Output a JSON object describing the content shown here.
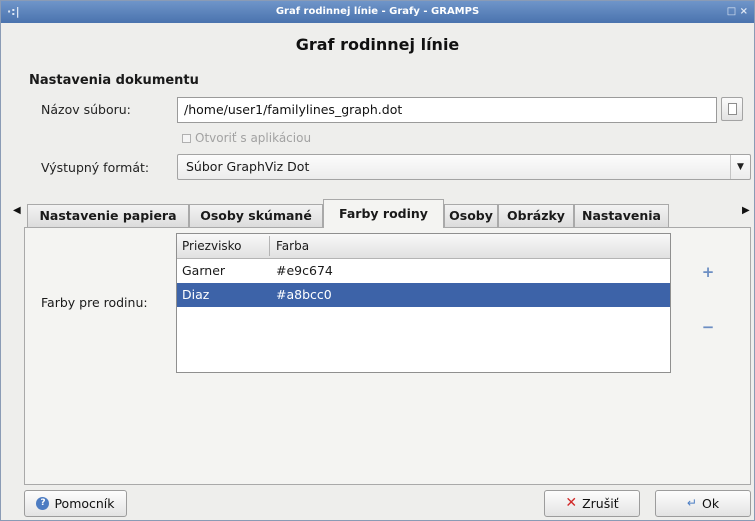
{
  "window": {
    "title": "Graf rodinnej línie - Grafy - GRAMPS",
    "menu_glyph": "·:|",
    "close_glyph": "□ ×"
  },
  "header": {
    "title": "Graf rodinnej línie"
  },
  "document_settings": {
    "section_title": "Nastavenia dokumentu",
    "filename_label": "Názov súboru:",
    "filename_value": "/home/user1/familylines_graph.dot",
    "open_with_app_label": "Otvoriť s aplikáciou",
    "open_with_app_checked": false,
    "format_label": "Výstupný formát:",
    "format_value": "Súbor GraphViz Dot"
  },
  "tabs": [
    {
      "label": "Nastavenie papiera",
      "active": false
    },
    {
      "label": "Osoby skúmané",
      "active": false
    },
    {
      "label": "Farby rodiny",
      "active": true
    },
    {
      "label": "Osoby",
      "active": false
    },
    {
      "label": "Obrázky",
      "active": false
    },
    {
      "label": "Nastavenia",
      "active": false
    }
  ],
  "family_colors": {
    "label": "Farby pre rodinu:",
    "columns": [
      "Priezvisko",
      "Farba"
    ],
    "rows": [
      {
        "surname": "Garner",
        "color": "#e9c674",
        "selected": false
      },
      {
        "surname": "Diaz",
        "color": "#a8bcc0",
        "selected": true
      }
    ],
    "add_glyph": "+",
    "remove_glyph": "−"
  },
  "footer": {
    "help_label": "Pomocník",
    "cancel_label": "Zrušiť",
    "ok_label": "Ok"
  },
  "colors": {
    "titlebar": "#4a73ae",
    "selection": "#3d63a8",
    "dialog_bg": "#eeeeec"
  }
}
